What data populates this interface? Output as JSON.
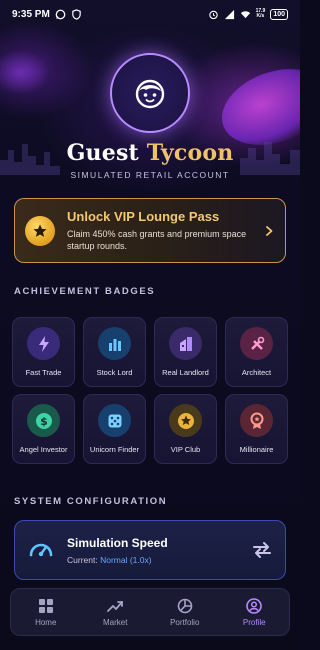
{
  "status_bar": {
    "time": "9:35 PM",
    "net_speed": "17.9",
    "net_unit": "K/s",
    "battery": "100"
  },
  "profile": {
    "avatar_icon": "face-avatar-icon",
    "name_first": "Guest",
    "name_second": "Tycoon",
    "subtitle": "SIMULATED RETAIL ACCOUNT"
  },
  "vip": {
    "icon": "star-badge-icon",
    "title": "Unlock VIP Lounge Pass",
    "description": "Claim 450% cash grants and premium space startup rounds.",
    "accent": "#f3c873"
  },
  "achievements": {
    "heading": "ACHIEVEMENT BADGES",
    "items": [
      {
        "label": "Fast Trade",
        "icon": "lightning-icon"
      },
      {
        "label": "Stock Lord",
        "icon": "bar-chart-icon"
      },
      {
        "label": "Real Landlord",
        "icon": "building-icon"
      },
      {
        "label": "Architect",
        "icon": "tools-icon"
      },
      {
        "label": "Angel Investor",
        "icon": "dollar-icon"
      },
      {
        "label": "Unicorn Finder",
        "icon": "dice-icon"
      },
      {
        "label": "VIP Club",
        "icon": "star-icon"
      },
      {
        "label": "Millionaire",
        "icon": "medal-icon"
      }
    ]
  },
  "system": {
    "heading": "SYSTEM CONFIGURATION",
    "title": "Simulation Speed",
    "current_label": "Current:",
    "current_value": "Normal (1.0x)"
  },
  "nav": {
    "items": [
      {
        "label": "Home",
        "icon": "grid-icon"
      },
      {
        "label": "Market",
        "icon": "trend-icon"
      },
      {
        "label": "Portfolio",
        "icon": "pie-icon"
      },
      {
        "label": "Profile",
        "icon": "user-circle-icon"
      }
    ],
    "active": "Profile"
  }
}
